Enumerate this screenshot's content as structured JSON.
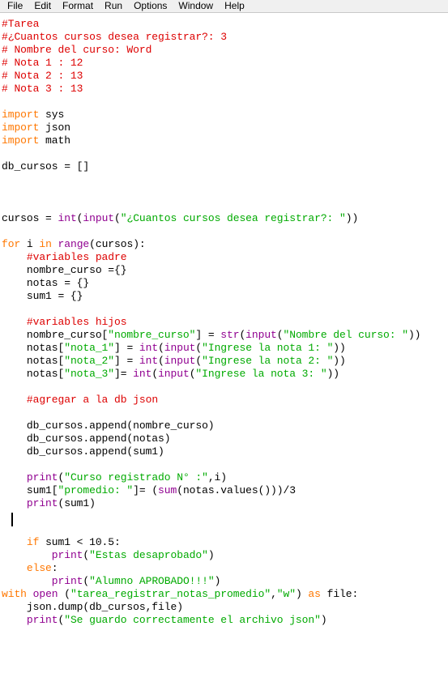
{
  "window": {
    "app": "IDLE Python Editor",
    "background": "#ffffff"
  },
  "menubar": {
    "items": [
      {
        "label": "File"
      },
      {
        "label": "Edit"
      },
      {
        "label": "Format"
      },
      {
        "label": "Run"
      },
      {
        "label": "Options"
      },
      {
        "label": "Window"
      },
      {
        "label": "Help"
      }
    ]
  },
  "colors": {
    "keyword": "#ff7700",
    "builtin": "#900090",
    "string": "#00aa00",
    "comment": "#dd0000",
    "plain": "#000000",
    "menubar_bg": "#f0f0f0",
    "editor_bg": "#ffffff"
  },
  "editor": {
    "caret": {
      "line": 38,
      "column": 0,
      "visible": true
    },
    "lines": [
      [
        {
          "t": "#Tarea",
          "c": "cmt"
        }
      ],
      [
        {
          "t": "#¿Cuantos cursos desea registrar?: 3",
          "c": "cmt"
        }
      ],
      [
        {
          "t": "# Nombre del curso: Word",
          "c": "cmt"
        }
      ],
      [
        {
          "t": "# Nota 1 : 12",
          "c": "cmt"
        }
      ],
      [
        {
          "t": "# Nota 2 : 13",
          "c": "cmt"
        }
      ],
      [
        {
          "t": "# Nota 3 : 13",
          "c": "cmt"
        }
      ],
      [],
      [
        {
          "t": "import",
          "c": "kw"
        },
        {
          "t": " sys",
          "c": "pln"
        }
      ],
      [
        {
          "t": "import",
          "c": "kw"
        },
        {
          "t": " json",
          "c": "pln"
        }
      ],
      [
        {
          "t": "import",
          "c": "kw"
        },
        {
          "t": " math",
          "c": "pln"
        }
      ],
      [],
      [
        {
          "t": "db_cursos = []",
          "c": "pln"
        }
      ],
      [],
      [],
      [],
      [
        {
          "t": "cursos = ",
          "c": "pln"
        },
        {
          "t": "int",
          "c": "bi"
        },
        {
          "t": "(",
          "c": "pln"
        },
        {
          "t": "input",
          "c": "bi"
        },
        {
          "t": "(",
          "c": "pln"
        },
        {
          "t": "\"¿Cuantos cursos desea registrar?: \"",
          "c": "str"
        },
        {
          "t": "))",
          "c": "pln"
        }
      ],
      [],
      [
        {
          "t": "for",
          "c": "kw"
        },
        {
          "t": " i ",
          "c": "pln"
        },
        {
          "t": "in",
          "c": "kw"
        },
        {
          "t": " ",
          "c": "pln"
        },
        {
          "t": "range",
          "c": "bi"
        },
        {
          "t": "(cursos):",
          "c": "pln"
        }
      ],
      [
        {
          "t": "    ",
          "c": "pln"
        },
        {
          "t": "#variables padre",
          "c": "cmt"
        }
      ],
      [
        {
          "t": "    nombre_curso ={}",
          "c": "pln"
        }
      ],
      [
        {
          "t": "    notas = {}",
          "c": "pln"
        }
      ],
      [
        {
          "t": "    sum1 = {}",
          "c": "pln"
        }
      ],
      [],
      [
        {
          "t": "    ",
          "c": "pln"
        },
        {
          "t": "#variables hijos",
          "c": "cmt"
        }
      ],
      [
        {
          "t": "    nombre_curso[",
          "c": "pln"
        },
        {
          "t": "\"nombre_curso\"",
          "c": "str"
        },
        {
          "t": "] = ",
          "c": "pln"
        },
        {
          "t": "str",
          "c": "bi"
        },
        {
          "t": "(",
          "c": "pln"
        },
        {
          "t": "input",
          "c": "bi"
        },
        {
          "t": "(",
          "c": "pln"
        },
        {
          "t": "\"Nombre del curso: \"",
          "c": "str"
        },
        {
          "t": "))",
          "c": "pln"
        }
      ],
      [
        {
          "t": "    notas[",
          "c": "pln"
        },
        {
          "t": "\"nota_1\"",
          "c": "str"
        },
        {
          "t": "] = ",
          "c": "pln"
        },
        {
          "t": "int",
          "c": "bi"
        },
        {
          "t": "(",
          "c": "pln"
        },
        {
          "t": "input",
          "c": "bi"
        },
        {
          "t": "(",
          "c": "pln"
        },
        {
          "t": "\"Ingrese la nota 1: \"",
          "c": "str"
        },
        {
          "t": "))",
          "c": "pln"
        }
      ],
      [
        {
          "t": "    notas[",
          "c": "pln"
        },
        {
          "t": "\"nota_2\"",
          "c": "str"
        },
        {
          "t": "] = ",
          "c": "pln"
        },
        {
          "t": "int",
          "c": "bi"
        },
        {
          "t": "(",
          "c": "pln"
        },
        {
          "t": "input",
          "c": "bi"
        },
        {
          "t": "(",
          "c": "pln"
        },
        {
          "t": "\"Ingrese la nota 2: \"",
          "c": "str"
        },
        {
          "t": "))",
          "c": "pln"
        }
      ],
      [
        {
          "t": "    notas[",
          "c": "pln"
        },
        {
          "t": "\"nota_3\"",
          "c": "str"
        },
        {
          "t": "]= ",
          "c": "pln"
        },
        {
          "t": "int",
          "c": "bi"
        },
        {
          "t": "(",
          "c": "pln"
        },
        {
          "t": "input",
          "c": "bi"
        },
        {
          "t": "(",
          "c": "pln"
        },
        {
          "t": "\"Ingrese la nota 3: \"",
          "c": "str"
        },
        {
          "t": "))",
          "c": "pln"
        }
      ],
      [],
      [
        {
          "t": "    ",
          "c": "pln"
        },
        {
          "t": "#agregar a la db json",
          "c": "cmt"
        }
      ],
      [],
      [
        {
          "t": "    db_cursos.append(nombre_curso)",
          "c": "pln"
        }
      ],
      [
        {
          "t": "    db_cursos.append(notas)",
          "c": "pln"
        }
      ],
      [
        {
          "t": "    db_cursos.append(sum1)",
          "c": "pln"
        }
      ],
      [],
      [
        {
          "t": "    ",
          "c": "pln"
        },
        {
          "t": "print",
          "c": "bi"
        },
        {
          "t": "(",
          "c": "pln"
        },
        {
          "t": "\"Curso registrado N° :\"",
          "c": "str"
        },
        {
          "t": ",i)",
          "c": "pln"
        }
      ],
      [
        {
          "t": "    sum1[",
          "c": "pln"
        },
        {
          "t": "\"promedio: \"",
          "c": "str"
        },
        {
          "t": "]= (",
          "c": "pln"
        },
        {
          "t": "sum",
          "c": "bi"
        },
        {
          "t": "(notas.values()))/3",
          "c": "pln"
        }
      ],
      [
        {
          "t": "    ",
          "c": "pln"
        },
        {
          "t": "print",
          "c": "bi"
        },
        {
          "t": "(sum1)",
          "c": "pln"
        }
      ],
      [],
      [],
      [
        {
          "t": "    ",
          "c": "pln"
        },
        {
          "t": "if",
          "c": "kw"
        },
        {
          "t": " sum1 < 10.5:",
          "c": "pln"
        }
      ],
      [
        {
          "t": "        ",
          "c": "pln"
        },
        {
          "t": "print",
          "c": "bi"
        },
        {
          "t": "(",
          "c": "pln"
        },
        {
          "t": "\"Estas desaprobado\"",
          "c": "str"
        },
        {
          "t": ")",
          "c": "pln"
        }
      ],
      [
        {
          "t": "    ",
          "c": "pln"
        },
        {
          "t": "else",
          "c": "kw"
        },
        {
          "t": ":",
          "c": "pln"
        }
      ],
      [
        {
          "t": "        ",
          "c": "pln"
        },
        {
          "t": "print",
          "c": "bi"
        },
        {
          "t": "(",
          "c": "pln"
        },
        {
          "t": "\"Alumno APROBADO!!!\"",
          "c": "str"
        },
        {
          "t": ")",
          "c": "pln"
        }
      ],
      [
        {
          "t": "with",
          "c": "kw"
        },
        {
          "t": " ",
          "c": "pln"
        },
        {
          "t": "open",
          "c": "bi"
        },
        {
          "t": " (",
          "c": "pln"
        },
        {
          "t": "\"tarea_registrar_notas_promedio\"",
          "c": "str"
        },
        {
          "t": ",",
          "c": "pln"
        },
        {
          "t": "\"w\"",
          "c": "str"
        },
        {
          "t": ") ",
          "c": "pln"
        },
        {
          "t": "as",
          "c": "kw"
        },
        {
          "t": " file:",
          "c": "pln"
        }
      ],
      [
        {
          "t": "    json.dump(db_cursos,file)",
          "c": "pln"
        }
      ],
      [
        {
          "t": "    ",
          "c": "pln"
        },
        {
          "t": "print",
          "c": "bi"
        },
        {
          "t": "(",
          "c": "pln"
        },
        {
          "t": "\"Se guardo correctamente el archivo json\"",
          "c": "str"
        },
        {
          "t": ")",
          "c": "pln"
        }
      ]
    ]
  }
}
